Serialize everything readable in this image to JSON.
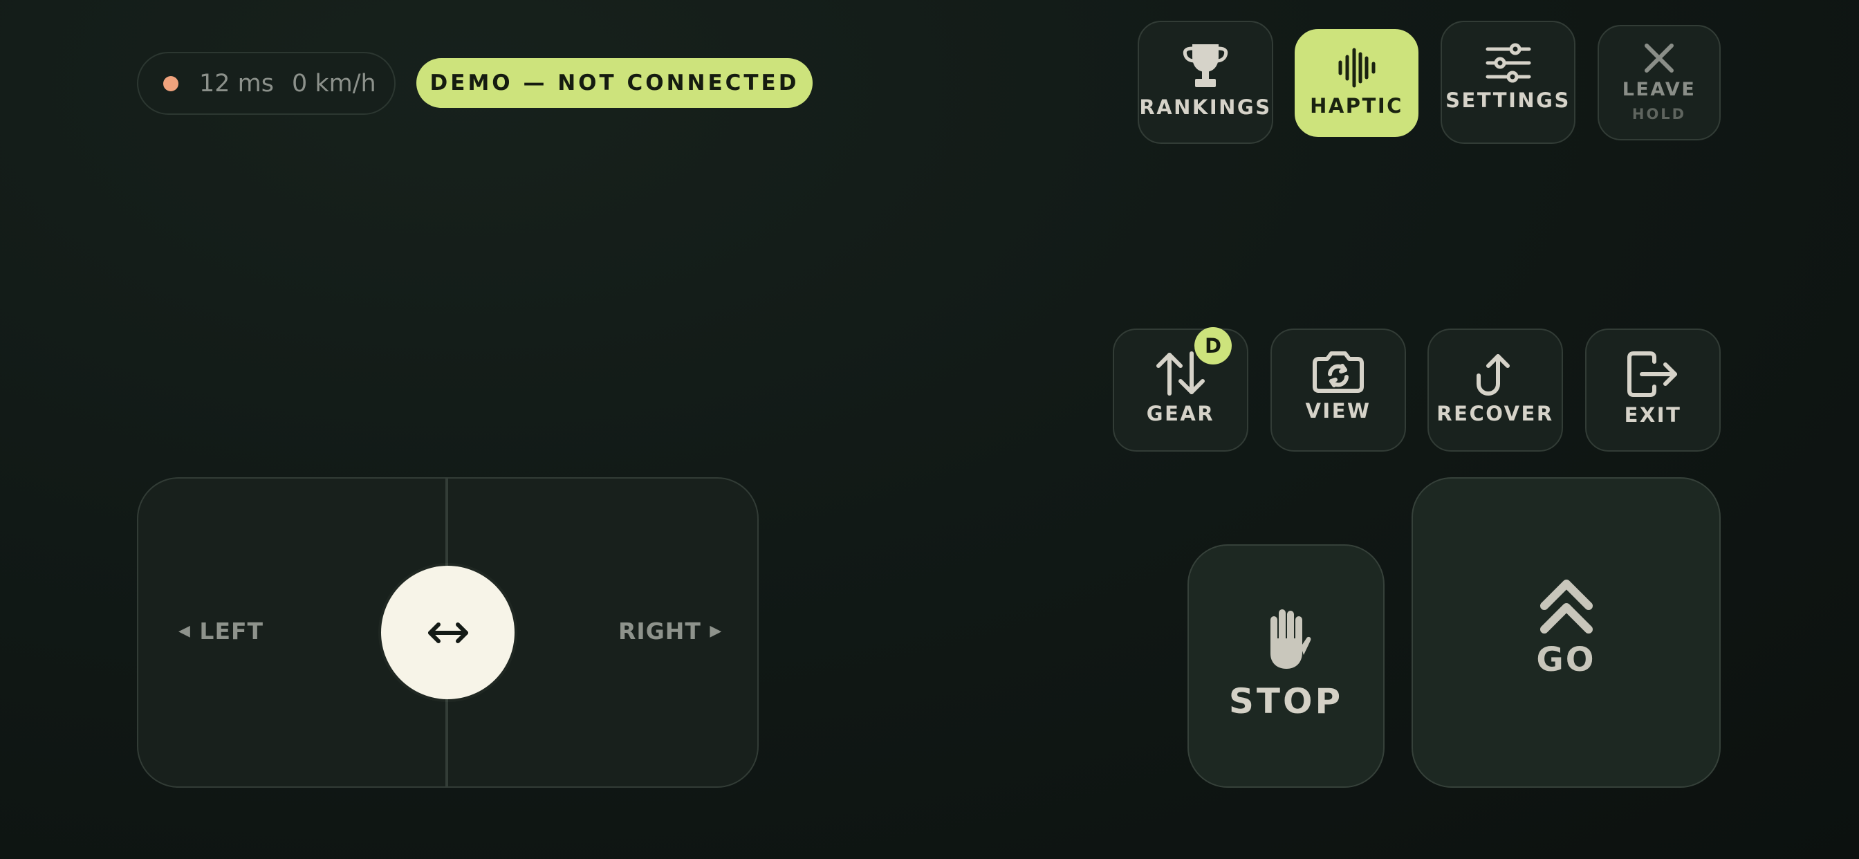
{
  "status": {
    "latency": "12 ms",
    "speed": "0 km/h",
    "indicator_color": "#f0a37d"
  },
  "demo_badge": "DEMO — NOT CONNECTED",
  "top_buttons": {
    "rankings": {
      "label": "RANKINGS",
      "icon": "trophy-icon"
    },
    "haptic": {
      "label": "HAPTIC",
      "icon": "waveform-icon",
      "active": true
    },
    "settings": {
      "label": "SETTINGS",
      "icon": "sliders-icon"
    },
    "leave": {
      "label": "LEAVE",
      "sublabel": "HOLD",
      "icon": "close-icon"
    }
  },
  "action_buttons": {
    "gear": {
      "label": "GEAR",
      "badge": "D",
      "icon": "up-down-arrows-icon"
    },
    "view": {
      "label": "VIEW",
      "icon": "camera-rotate-icon"
    },
    "recover": {
      "label": "RECOVER",
      "icon": "u-turn-arrow-icon"
    },
    "exit": {
      "label": "EXIT",
      "icon": "exit-door-icon"
    }
  },
  "steering": {
    "left_label": "LEFT",
    "right_label": "RIGHT"
  },
  "pedals": {
    "stop_label": "STOP",
    "go_label": "GO"
  },
  "colors": {
    "accent": "#cde37c",
    "background": "#111916",
    "knob": "#f7f4e8"
  }
}
